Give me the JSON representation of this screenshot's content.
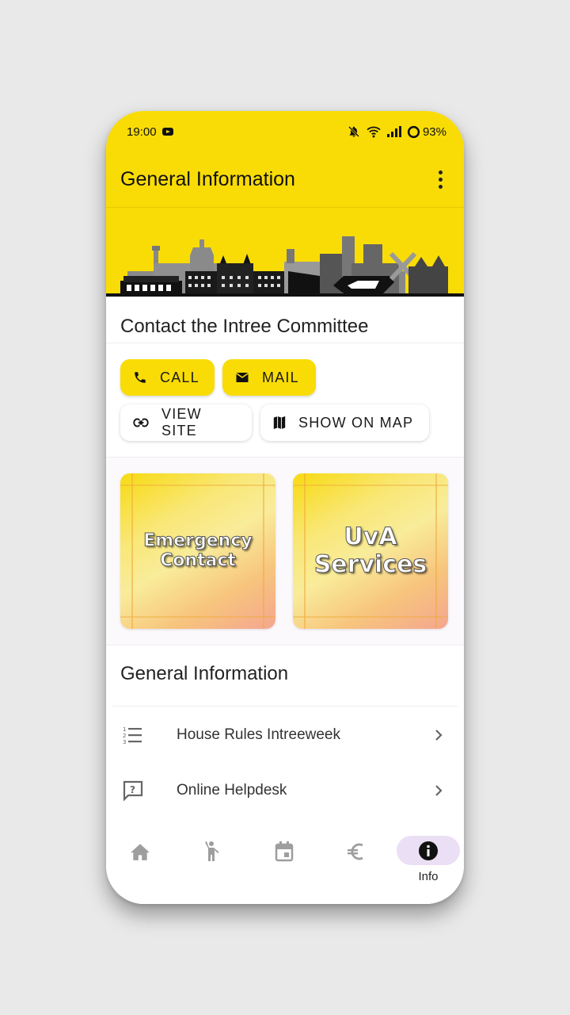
{
  "status_bar": {
    "time": "19:00",
    "notification_icon": "youtube-icon",
    "icons": [
      "mute-icon",
      "wifi-icon",
      "signal-icon",
      "battery-ring-icon"
    ],
    "battery": "93%"
  },
  "app_bar": {
    "title": "General Information",
    "menu_icon": "more-vertical-icon"
  },
  "banner": {
    "image": "amsterdam-skyline"
  },
  "contact": {
    "title": "Contact the Intree Committee",
    "buttons": [
      {
        "label": "CALL",
        "icon": "phone-icon",
        "style": "filled"
      },
      {
        "label": "MAIL",
        "icon": "mail-icon",
        "style": "filled"
      },
      {
        "label": "VIEW SITE",
        "icon": "link-icon",
        "style": "outlined"
      },
      {
        "label": "SHOW ON MAP",
        "icon": "map-icon",
        "style": "outlined"
      }
    ]
  },
  "cards": [
    {
      "label_line1": "Emergency",
      "label_line2": "Contact"
    },
    {
      "label_line1": "UvA",
      "label_line2": "Services"
    }
  ],
  "general": {
    "title": "General Information",
    "items": [
      {
        "label": "House Rules Intreeweek",
        "icon": "numbered-list-icon"
      },
      {
        "label": "Online Helpdesk",
        "icon": "help-chat-icon"
      }
    ]
  },
  "nav": {
    "items": [
      {
        "name": "home",
        "icon": "home-icon",
        "label": ""
      },
      {
        "name": "activities",
        "icon": "person-waving-icon",
        "label": ""
      },
      {
        "name": "calendar",
        "icon": "calendar-icon",
        "label": ""
      },
      {
        "name": "finance",
        "icon": "euro-icon",
        "label": ""
      },
      {
        "name": "info",
        "icon": "info-icon",
        "label": "Info",
        "active": true
      }
    ]
  },
  "colors": {
    "accent": "#f9dc06",
    "active_nav_pill": "#ebdff5",
    "inactive_icon": "#9e9e9e"
  }
}
